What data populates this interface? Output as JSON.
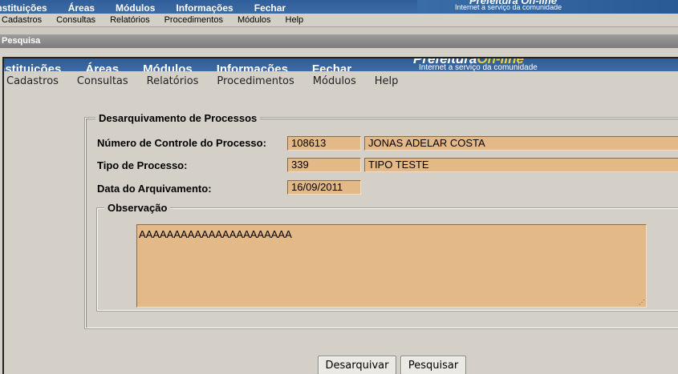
{
  "outer": {
    "nav": [
      "Instituições",
      "Áreas",
      "Módulos",
      "Informações",
      "Fechar"
    ],
    "brand_subtitle": "Internet a serviço da comunidade",
    "brand_logo": "Prefeitura On-line",
    "menu": [
      "Cadastros",
      "Consultas",
      "Relatórios",
      "Procedimentos",
      "Módulos",
      "Help"
    ],
    "window_title": "Pesquisa"
  },
  "inner": {
    "nav": [
      "Instituições",
      "Áreas",
      "Módulos",
      "Informações",
      "Fechar"
    ],
    "brand_logo_main": "Prefeitura",
    "brand_logo_accent": "On-line",
    "brand_subtitle": "Internet a serviço da comunidade",
    "menu": [
      "Cadastros",
      "Consultas",
      "Relatórios",
      "Procedimentos",
      "Módulos",
      "Help"
    ]
  },
  "form": {
    "legend": "Desarquivamento de Processos",
    "numero_label": "Número de Controle do Processo:",
    "numero_value": "108613",
    "nome_value": "JONAS ADELAR COSTA",
    "tipo_label": "Tipo de Processo:",
    "tipo_code": "339",
    "tipo_desc": "TIPO TESTE",
    "data_label": "Data do Arquivamento:",
    "data_value": "16/09/2011",
    "obs_legend": "Observação",
    "obs_value": "AAAAAAAAAAAAAAAAAAAAAA"
  },
  "buttons": {
    "desarquivar": "Desarquivar",
    "pesquisar": "Pesquisar"
  },
  "colors": {
    "field_bg": "#e3b988",
    "banner_blue": "#2e5b93",
    "window_bg": "#d4d0c8"
  }
}
